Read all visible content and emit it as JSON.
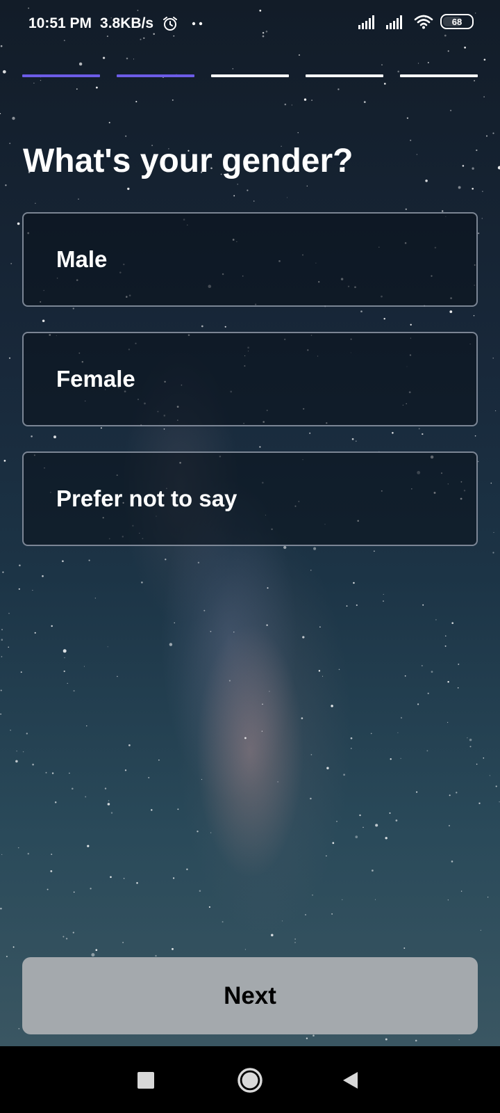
{
  "status_bar": {
    "time": "10:51 PM",
    "network_speed": "3.8KB/s",
    "battery_level": "68",
    "icons": [
      "alarm-icon",
      "dots-icon",
      "signal-icon",
      "signal-icon",
      "wifi-icon",
      "battery-icon"
    ]
  },
  "progress": {
    "total_steps": 5,
    "completed_steps": 2,
    "active_color": "#6c5ce7",
    "inactive_color": "#ffffff"
  },
  "question": {
    "title": "What's your gender?"
  },
  "options": [
    {
      "label": "Male"
    },
    {
      "label": "Female"
    },
    {
      "label": "Prefer not to say"
    }
  ],
  "actions": {
    "next_label": "Next"
  },
  "nav_bar": {
    "icons": [
      "recent-apps-icon",
      "home-icon",
      "back-icon"
    ]
  }
}
